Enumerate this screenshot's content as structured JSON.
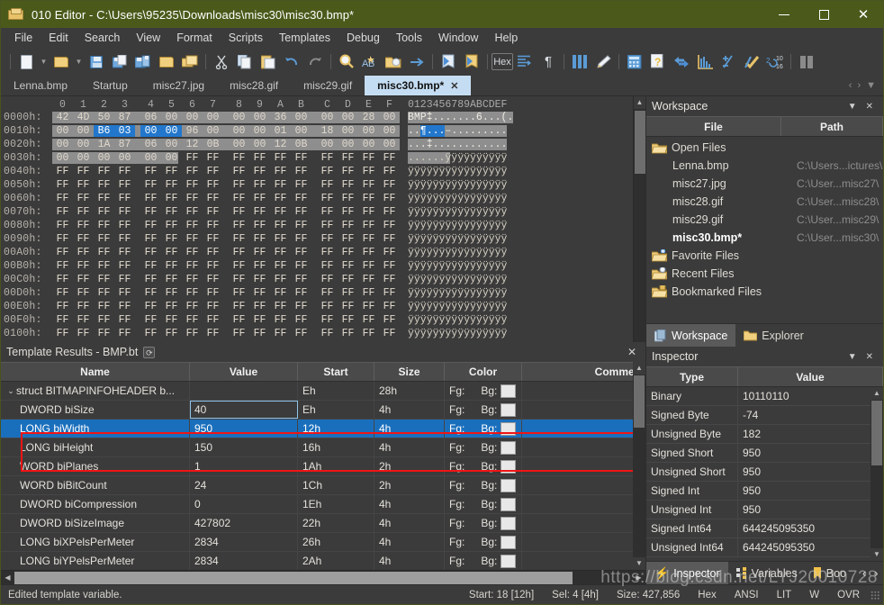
{
  "window": {
    "title": "010 Editor - C:\\Users\\95235\\Downloads\\misc30\\misc30.bmp*",
    "minimize": "—",
    "maximize": "□",
    "close": "✕",
    "accent": "#4b5a1b"
  },
  "menu": [
    "File",
    "Edit",
    "Search",
    "View",
    "Format",
    "Scripts",
    "Templates",
    "Debug",
    "Tools",
    "Window",
    "Help"
  ],
  "toolbar": {
    "groups": [
      [
        "new-file",
        "caret-new",
        "open-file",
        "caret-open",
        "save-file",
        "save-as",
        "save-all",
        "open-folder",
        "open-project"
      ],
      [
        "cut",
        "copy",
        "paste",
        "undo",
        "redo"
      ],
      [
        "find",
        "find-replace",
        "find-in-files",
        "goto"
      ],
      [
        "import-hex",
        "export-hex"
      ],
      [
        "hex-mode",
        "align-text",
        "paragraph-marks"
      ],
      [
        "column-mode",
        "highlight",
        "calculator",
        "help-file",
        "compare",
        "histogram",
        "checksum",
        "check-script",
        "base-convert"
      ],
      [
        "split-view"
      ]
    ],
    "hex_label": "Hex",
    "base_label_top": "10",
    "base_label_bot": "16"
  },
  "tabs": {
    "items": [
      {
        "label": "Lenna.bmp",
        "active": false
      },
      {
        "label": "Startup",
        "active": false
      },
      {
        "label": "misc27.jpg",
        "active": false
      },
      {
        "label": "misc28.gif",
        "active": false
      },
      {
        "label": "misc29.gif",
        "active": false
      },
      {
        "label": "misc30.bmp*",
        "active": true,
        "close": "✕"
      }
    ],
    "nav": {
      "prev": "‹",
      "next": "›",
      "list": "▼"
    }
  },
  "hex": {
    "column_headers": [
      "0",
      "1",
      "2",
      "3",
      "4",
      "5",
      "6",
      "7",
      "8",
      "9",
      "A",
      "B",
      "C",
      "D",
      "E",
      "F"
    ],
    "ascii_header": "0123456789ABCDEF",
    "rows": [
      {
        "offset": "0000h:",
        "bytes": [
          "42",
          "4D",
          "50",
          "87",
          "06",
          "00",
          "00",
          "00",
          "00",
          "00",
          "36",
          "00",
          "00",
          "00",
          "28",
          "00"
        ],
        "ascii": "BMP‡.......6...(.",
        "band": "light"
      },
      {
        "offset": "0010h:",
        "bytes": [
          "00",
          "00",
          "B6",
          "03",
          "00",
          "00",
          "96",
          "00",
          "00",
          "00",
          "01",
          "00",
          "18",
          "00",
          "00",
          "00"
        ],
        "ascii": "..¶....–.........",
        "band": "light",
        "sel_from": 2,
        "sel_to": 5
      },
      {
        "offset": "0020h:",
        "bytes": [
          "00",
          "00",
          "1A",
          "87",
          "06",
          "00",
          "12",
          "0B",
          "00",
          "00",
          "12",
          "0B",
          "00",
          "00",
          "00",
          "00"
        ],
        "ascii": "...‡............",
        "band": "light"
      },
      {
        "offset": "0030h:",
        "bytes": [
          "00",
          "00",
          "00",
          "00",
          "00",
          "00",
          "FF",
          "FF",
          "FF",
          "FF",
          "FF",
          "FF",
          "FF",
          "FF",
          "FF",
          "FF"
        ],
        "ascii": "......ÿÿÿÿÿÿÿÿÿÿ",
        "band": "half"
      },
      {
        "offset": "0040h:",
        "bytes": [
          "FF",
          "FF",
          "FF",
          "FF",
          "FF",
          "FF",
          "FF",
          "FF",
          "FF",
          "FF",
          "FF",
          "FF",
          "FF",
          "FF",
          "FF",
          "FF"
        ],
        "ascii": "ÿÿÿÿÿÿÿÿÿÿÿÿÿÿÿÿ"
      },
      {
        "offset": "0050h:",
        "bytes": [
          "FF",
          "FF",
          "FF",
          "FF",
          "FF",
          "FF",
          "FF",
          "FF",
          "FF",
          "FF",
          "FF",
          "FF",
          "FF",
          "FF",
          "FF",
          "FF"
        ],
        "ascii": "ÿÿÿÿÿÿÿÿÿÿÿÿÿÿÿÿ"
      },
      {
        "offset": "0060h:",
        "bytes": [
          "FF",
          "FF",
          "FF",
          "FF",
          "FF",
          "FF",
          "FF",
          "FF",
          "FF",
          "FF",
          "FF",
          "FF",
          "FF",
          "FF",
          "FF",
          "FF"
        ],
        "ascii": "ÿÿÿÿÿÿÿÿÿÿÿÿÿÿÿÿ"
      },
      {
        "offset": "0070h:",
        "bytes": [
          "FF",
          "FF",
          "FF",
          "FF",
          "FF",
          "FF",
          "FF",
          "FF",
          "FF",
          "FF",
          "FF",
          "FF",
          "FF",
          "FF",
          "FF",
          "FF"
        ],
        "ascii": "ÿÿÿÿÿÿÿÿÿÿÿÿÿÿÿÿ"
      },
      {
        "offset": "0080h:",
        "bytes": [
          "FF",
          "FF",
          "FF",
          "FF",
          "FF",
          "FF",
          "FF",
          "FF",
          "FF",
          "FF",
          "FF",
          "FF",
          "FF",
          "FF",
          "FF",
          "FF"
        ],
        "ascii": "ÿÿÿÿÿÿÿÿÿÿÿÿÿÿÿÿ"
      },
      {
        "offset": "0090h:",
        "bytes": [
          "FF",
          "FF",
          "FF",
          "FF",
          "FF",
          "FF",
          "FF",
          "FF",
          "FF",
          "FF",
          "FF",
          "FF",
          "FF",
          "FF",
          "FF",
          "FF"
        ],
        "ascii": "ÿÿÿÿÿÿÿÿÿÿÿÿÿÿÿÿ"
      },
      {
        "offset": "00A0h:",
        "bytes": [
          "FF",
          "FF",
          "FF",
          "FF",
          "FF",
          "FF",
          "FF",
          "FF",
          "FF",
          "FF",
          "FF",
          "FF",
          "FF",
          "FF",
          "FF",
          "FF"
        ],
        "ascii": "ÿÿÿÿÿÿÿÿÿÿÿÿÿÿÿÿ"
      },
      {
        "offset": "00B0h:",
        "bytes": [
          "FF",
          "FF",
          "FF",
          "FF",
          "FF",
          "FF",
          "FF",
          "FF",
          "FF",
          "FF",
          "FF",
          "FF",
          "FF",
          "FF",
          "FF",
          "FF"
        ],
        "ascii": "ÿÿÿÿÿÿÿÿÿÿÿÿÿÿÿÿ"
      },
      {
        "offset": "00C0h:",
        "bytes": [
          "FF",
          "FF",
          "FF",
          "FF",
          "FF",
          "FF",
          "FF",
          "FF",
          "FF",
          "FF",
          "FF",
          "FF",
          "FF",
          "FF",
          "FF",
          "FF"
        ],
        "ascii": "ÿÿÿÿÿÿÿÿÿÿÿÿÿÿÿÿ"
      },
      {
        "offset": "00D0h:",
        "bytes": [
          "FF",
          "FF",
          "FF",
          "FF",
          "FF",
          "FF",
          "FF",
          "FF",
          "FF",
          "FF",
          "FF",
          "FF",
          "FF",
          "FF",
          "FF",
          "FF"
        ],
        "ascii": "ÿÿÿÿÿÿÿÿÿÿÿÿÿÿÿÿ"
      },
      {
        "offset": "00E0h:",
        "bytes": [
          "FF",
          "FF",
          "FF",
          "FF",
          "FF",
          "FF",
          "FF",
          "FF",
          "FF",
          "FF",
          "FF",
          "FF",
          "FF",
          "FF",
          "FF",
          "FF"
        ],
        "ascii": "ÿÿÿÿÿÿÿÿÿÿÿÿÿÿÿÿ"
      },
      {
        "offset": "00F0h:",
        "bytes": [
          "FF",
          "FF",
          "FF",
          "FF",
          "FF",
          "FF",
          "FF",
          "FF",
          "FF",
          "FF",
          "FF",
          "FF",
          "FF",
          "FF",
          "FF",
          "FF"
        ],
        "ascii": "ÿÿÿÿÿÿÿÿÿÿÿÿÿÿÿÿ"
      },
      {
        "offset": "0100h:",
        "bytes": [
          "FF",
          "FF",
          "FF",
          "FF",
          "FF",
          "FF",
          "FF",
          "FF",
          "FF",
          "FF",
          "FF",
          "FF",
          "FF",
          "FF",
          "FF",
          "FF"
        ],
        "ascii": "ÿÿÿÿÿÿÿÿÿÿÿÿÿÿÿÿ"
      }
    ]
  },
  "template": {
    "title": "Template Results - BMP.bt",
    "refresh_icon": "⟳",
    "close_icon": "✕",
    "columns": [
      "Name",
      "Value",
      "Start",
      "Size",
      "Color",
      "Commen"
    ],
    "color_fg_label": "Fg:",
    "color_bg_label": "Bg:",
    "rows": [
      {
        "name": "struct BITMAPINFOHEADER b...",
        "value": "",
        "start": "Eh",
        "size": "28h",
        "expander": "⌄",
        "indent": 0
      },
      {
        "name": "DWORD biSize",
        "value": "40",
        "start": "Eh",
        "size": "4h",
        "indent": 1
      },
      {
        "name": "LONG biWidth",
        "value": "950",
        "start": "12h",
        "size": "4h",
        "indent": 1,
        "selected": true
      },
      {
        "name": "LONG biHeight",
        "value": "150",
        "start": "16h",
        "size": "4h",
        "indent": 1
      },
      {
        "name": "WORD biPlanes",
        "value": "1",
        "start": "1Ah",
        "size": "2h",
        "indent": 1
      },
      {
        "name": "WORD biBitCount",
        "value": "24",
        "start": "1Ch",
        "size": "2h",
        "indent": 1
      },
      {
        "name": "DWORD biCompression",
        "value": "0",
        "start": "1Eh",
        "size": "4h",
        "indent": 1
      },
      {
        "name": "DWORD biSizeImage",
        "value": "427802",
        "start": "22h",
        "size": "4h",
        "indent": 1
      },
      {
        "name": "LONG biXPelsPerMeter",
        "value": "2834",
        "start": "26h",
        "size": "4h",
        "indent": 1
      },
      {
        "name": "LONG biYPelsPerMeter",
        "value": "2834",
        "start": "2Ah",
        "size": "4h",
        "indent": 1
      }
    ]
  },
  "workspace": {
    "title": "Workspace",
    "collapse_icon": "▼",
    "close_icon": "✕",
    "columns": [
      "File",
      "Path"
    ],
    "rows": [
      {
        "label": "Open Files",
        "path": "",
        "type": "folder",
        "level": 0
      },
      {
        "label": "Lenna.bmp",
        "path": "C:\\Users...ictures\\",
        "level": 1
      },
      {
        "label": "misc27.jpg",
        "path": "C:\\User...misc27\\",
        "level": 1
      },
      {
        "label": "misc28.gif",
        "path": "C:\\User...misc28\\",
        "level": 1
      },
      {
        "label": "misc29.gif",
        "path": "C:\\User...misc29\\",
        "level": 1
      },
      {
        "label": "misc30.bmp*",
        "path": "C:\\User...misc30\\",
        "level": 1,
        "bold": true
      },
      {
        "label": "Favorite Files",
        "path": "",
        "type": "folder-star",
        "level": 0
      },
      {
        "label": "Recent Files",
        "path": "",
        "type": "folder-clock",
        "level": 0
      },
      {
        "label": "Bookmarked Files",
        "path": "",
        "type": "folder-book",
        "level": 0
      }
    ],
    "tabs": [
      {
        "label": "Workspace",
        "icon": "workspace-icon",
        "active": true
      },
      {
        "label": "Explorer",
        "icon": "folder-icon",
        "active": false
      }
    ]
  },
  "inspector": {
    "title": "Inspector",
    "collapse_icon": "▼",
    "close_icon": "✕",
    "columns": [
      "Type",
      "Value"
    ],
    "rows": [
      {
        "type": "Binary",
        "value": "10110110"
      },
      {
        "type": "Signed Byte",
        "value": "-74"
      },
      {
        "type": "Unsigned Byte",
        "value": "182"
      },
      {
        "type": "Signed Short",
        "value": "950"
      },
      {
        "type": "Unsigned Short",
        "value": "950"
      },
      {
        "type": "Signed Int",
        "value": "950"
      },
      {
        "type": "Unsigned Int",
        "value": "950"
      },
      {
        "type": "Signed Int64",
        "value": "644245095350"
      },
      {
        "type": "Unsigned Int64",
        "value": "644245095350"
      }
    ],
    "tabs": [
      {
        "label": "Inspector",
        "icon": "lightning-icon",
        "active": true
      },
      {
        "label": "Variables",
        "icon": "variables-icon",
        "active": false
      },
      {
        "label": "Boo",
        "icon": "bookmark-icon",
        "active": false
      }
    ],
    "nav": {
      "prev": "‹",
      "next": "›"
    }
  },
  "status": {
    "message": "Edited template variable.",
    "start": "Start: 18 [12h]",
    "sel": "Sel: 4 [4h]",
    "size": "Size: 427,856",
    "mode": "Hex",
    "encoding": "ANSI",
    "endian": "LIT",
    "width": "W",
    "insert": "OVR"
  },
  "watermark": "https://blog.csdn.net/LYJ20010728"
}
